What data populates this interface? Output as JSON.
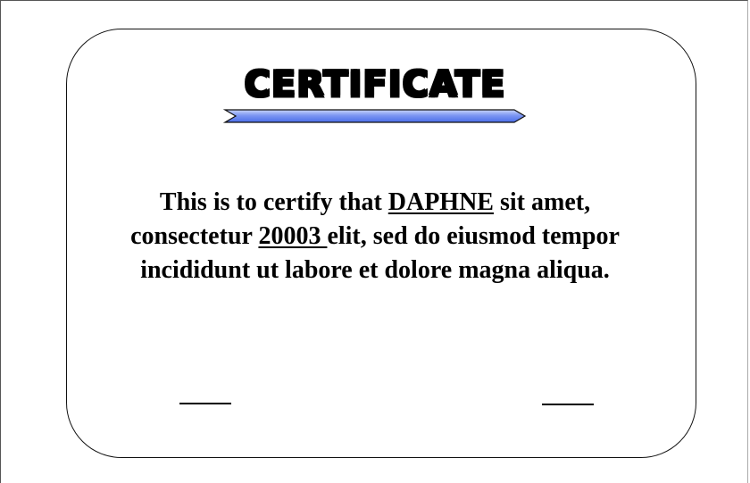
{
  "certificate": {
    "title": "CERTIFICATE",
    "body": {
      "prefix": "This is to certify that ",
      "name": "DAPHNE",
      "after_name": " sit amet,",
      "line2_prefix": "consectetur ",
      "code": "20003 ",
      "line2_suffix": "elit, sed do eiusmod tempor",
      "line3": "incididunt ut labore et dolore magna aliqua."
    }
  },
  "colors": {
    "ribbon_fill": "#5b7ef0",
    "ribbon_highlight": "#c8d4fb",
    "border": "#111111",
    "text": "#000000"
  }
}
